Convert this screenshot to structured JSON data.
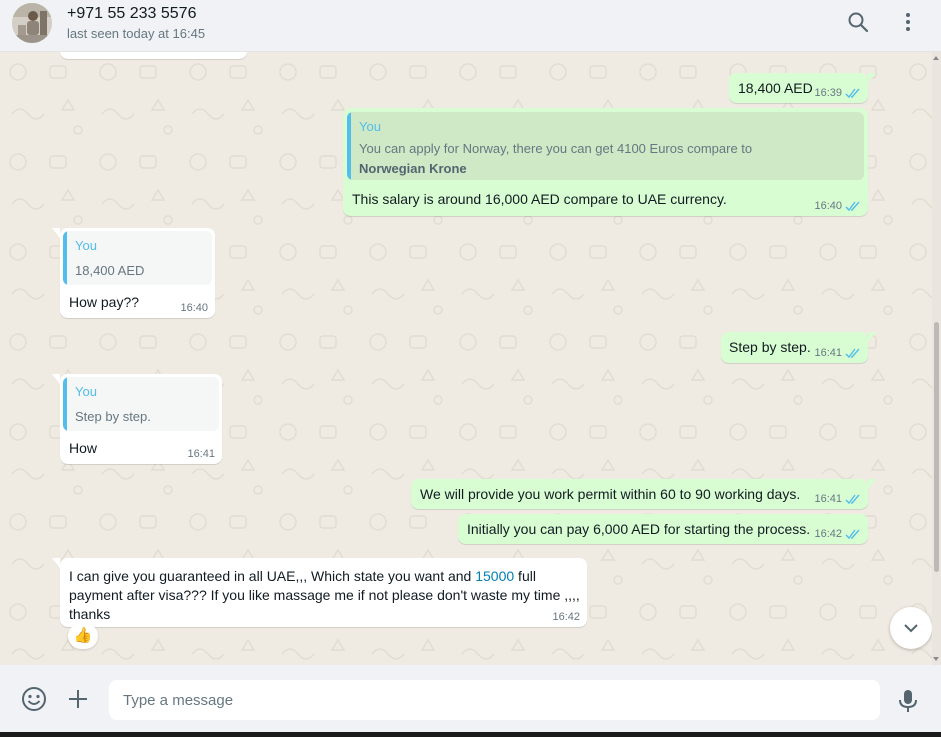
{
  "header": {
    "contact_name": "+971 55 233 5576",
    "status": "last seen today at 16:45",
    "icons": [
      "search-icon",
      "menu-kebab-icon"
    ]
  },
  "messages": [
    {
      "direction": "outgoing",
      "text": "18,400 AED",
      "time": "16:39",
      "ticks": "read"
    },
    {
      "direction": "outgoing",
      "quote": {
        "author": "You",
        "line1": "You can apply for Norway, there you can get 4100 Euros compare to",
        "line2": "Norwegian Krone"
      },
      "text": "This salary is around 16,000 AED compare to UAE currency.",
      "time": "16:40",
      "ticks": "read"
    },
    {
      "direction": "incoming",
      "quote": {
        "author": "You",
        "text": "18,400 AED"
      },
      "text": "How pay??",
      "time": "16:40"
    },
    {
      "direction": "outgoing",
      "text": "Step by step.",
      "time": "16:41",
      "ticks": "read"
    },
    {
      "direction": "incoming",
      "quote": {
        "author": "You",
        "text": "Step by step."
      },
      "text": "How",
      "time": "16:41"
    },
    {
      "direction": "outgoing",
      "text": "We will provide you work permit within 60 to 90 working days.",
      "time": "16:41",
      "ticks": "read"
    },
    {
      "direction": "outgoing",
      "text": "Initially you can pay 6,000 AED for starting the process.",
      "time": "16:42",
      "ticks": "read"
    },
    {
      "direction": "incoming",
      "text_before": "I can give you guaranteed in all UAE,,, Which state you want and ",
      "link_text": "15000",
      "text_after": " full payment after visa??? If you like massage me if not please don't waste my time ,,,, thanks",
      "time": "16:42",
      "reaction": "👍"
    }
  ],
  "composer": {
    "placeholder": "Type a message",
    "icons": [
      "emoji-icon",
      "attach-plus-icon",
      "microphone-icon"
    ]
  },
  "colors": {
    "outgoing_bubble": "#d9fdd3",
    "incoming_bubble": "#ffffff",
    "chat_background": "#efeae2",
    "read_ticks": "#53bdeb",
    "quote_bar": "#53bdeb",
    "link": "#027eb5"
  }
}
